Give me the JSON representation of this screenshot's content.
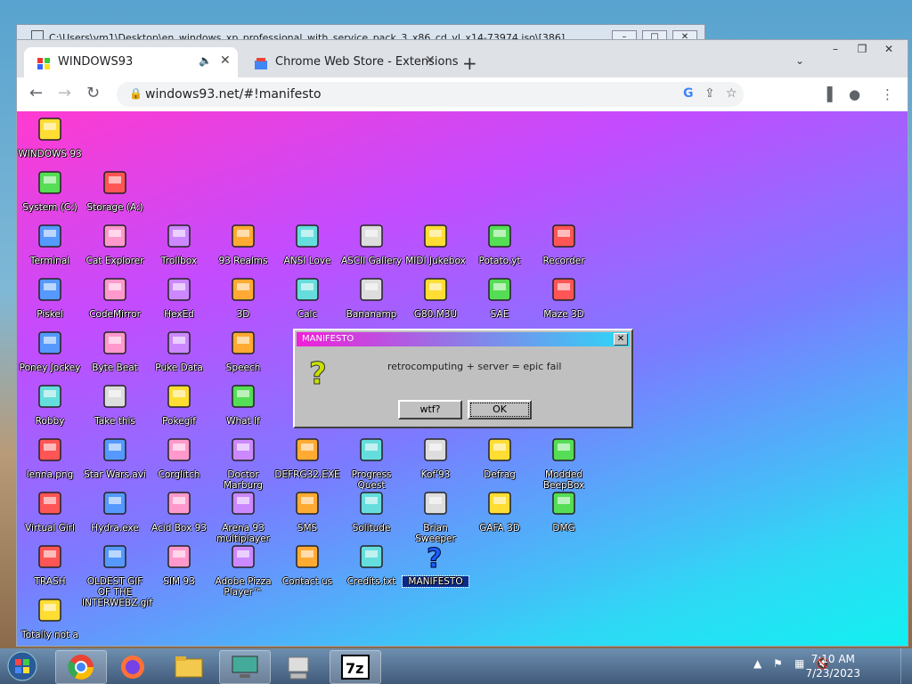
{
  "background_window": {
    "title": "C:\\Users\\vm1\\Desktop\\en_windows_xp_professional_with_service_pack_3_x86_cd_vl_x14-73974.iso\\[386]"
  },
  "browser": {
    "tabs": [
      {
        "label": "WINDOWS93"
      },
      {
        "label": "Chrome Web Store - Extensions"
      }
    ],
    "url": "windows93.net/#!manifesto"
  },
  "desktop_icons": [
    {
      "label": "WINDOWS 93",
      "icon": "computer-icon"
    },
    {
      "label": "System (C:)",
      "icon": "drive-icon"
    },
    {
      "label": "Storage (A:)",
      "icon": "floppy-drive-icon"
    },
    {
      "label": "Terminal",
      "icon": "terminal-icon"
    },
    {
      "label": "Cat Explorer",
      "icon": "globe-icon"
    },
    {
      "label": "Trollbox",
      "icon": "chat-icon"
    },
    {
      "label": "93 Realms",
      "icon": "mage-icon"
    },
    {
      "label": "ANSI Love",
      "icon": "letter-a-icon"
    },
    {
      "label": "ASCII Gallery",
      "icon": "numbers-icon"
    },
    {
      "label": "MIDI Jukebox",
      "icon": "piano-icon"
    },
    {
      "label": "Potato.yt",
      "icon": "potato-icon"
    },
    {
      "label": "Recorder",
      "icon": "microphone-icon"
    },
    {
      "label": "Piskel",
      "icon": "palette-icon"
    },
    {
      "label": "CodeMirror",
      "icon": "code-icon"
    },
    {
      "label": "HexEd",
      "icon": "cube-icon"
    },
    {
      "label": "3D",
      "icon": "teapot-icon"
    },
    {
      "label": "Calc",
      "icon": "calculator-icon"
    },
    {
      "label": "Bananamp",
      "icon": "banana-icon"
    },
    {
      "label": "G80.M3U",
      "icon": "playlist-icon"
    },
    {
      "label": "SAE",
      "icon": "ball-icon"
    },
    {
      "label": "Maze 3D",
      "icon": "maze-icon"
    },
    {
      "label": "Poney Jockey",
      "icon": "pony-icon"
    },
    {
      "label": "Byte Beat",
      "icon": "wave-icon"
    },
    {
      "label": "Puke Data",
      "icon": "pd-icon"
    },
    {
      "label": "Speech",
      "icon": "face-icon"
    },
    {
      "label": "Robby",
      "icon": "stickman-icon"
    },
    {
      "label": "Take this",
      "icon": "bearded-man-icon"
    },
    {
      "label": "Pokegif",
      "icon": "pokegif-icon"
    },
    {
      "label": "What If",
      "icon": "matrix-icon"
    },
    {
      "label": "lenna.png",
      "icon": "image-file-icon"
    },
    {
      "label": "Star Wars.avi",
      "icon": "yoda-icon"
    },
    {
      "label": "Corglitch",
      "icon": "corgi-icon"
    },
    {
      "label": "Doctor Marburg",
      "icon": "doctor-icon"
    },
    {
      "label": "DEFRG32.EXE",
      "icon": "monitor-face-icon"
    },
    {
      "label": "Progress Quest",
      "icon": "swords-icon"
    },
    {
      "label": "Kof'93",
      "icon": "fighter-icon"
    },
    {
      "label": "Defrag",
      "icon": "defrag-icon"
    },
    {
      "label": "Modded BeepBox",
      "icon": "ring-icon"
    },
    {
      "label": "Virtual Girl",
      "icon": "girl-icon"
    },
    {
      "label": "Hydra.exe",
      "icon": "hydra-icon"
    },
    {
      "label": "Acid Box 93",
      "icon": "smiley-icon"
    },
    {
      "label": "Arena 93 multiplayer",
      "icon": "arena-cube-icon"
    },
    {
      "label": "SMS",
      "icon": "console-icon"
    },
    {
      "label": "Solitude",
      "icon": "tape-icon"
    },
    {
      "label": "Brian Sweeper",
      "icon": "mine-icon"
    },
    {
      "label": "GAFA 3D",
      "icon": "head-icon"
    },
    {
      "label": "DMG",
      "icon": "gameboy-icon"
    },
    {
      "label": "TRASH",
      "icon": "trash-icon"
    },
    {
      "label": "OLDEST GIF OF THE INTERWEBZ.gif",
      "icon": "image-file-icon"
    },
    {
      "label": "SIM 93",
      "icon": "book-icon"
    },
    {
      "label": "Adobe Pizza Player™",
      "icon": "pizza-icon"
    },
    {
      "label": "Contact us",
      "icon": "envelope-icon"
    },
    {
      "label": "Credits.txt",
      "icon": "text-file-icon"
    },
    {
      "label": "MANIFESTO",
      "icon": "question-icon"
    },
    {
      "label": "Totally not a",
      "icon": "dolphin-icon"
    }
  ],
  "dialog": {
    "title": "MANIFESTO",
    "message": "retrocomputing + server = epic fail",
    "btn1": "wtf?",
    "btn2": "OK"
  },
  "taskbar": {
    "time": "7:10 AM",
    "date": "7/23/2023"
  }
}
